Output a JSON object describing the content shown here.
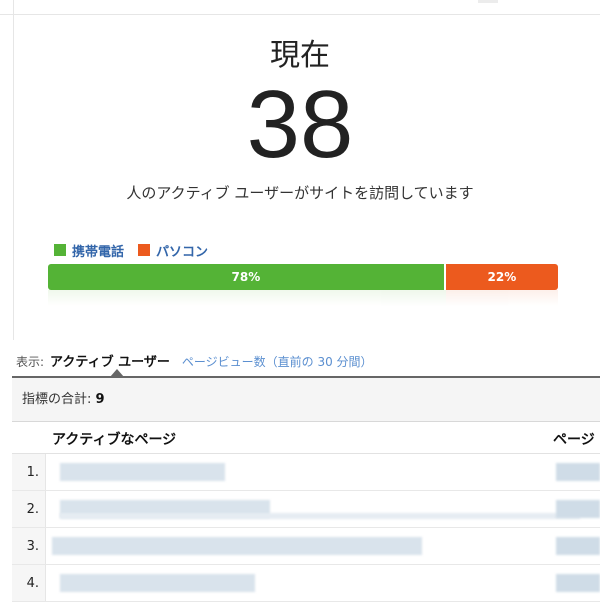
{
  "realtime": {
    "title": "現在",
    "active_count": "38",
    "subtitle": "人のアクティブ ユーザーがサイトを訪問しています"
  },
  "device_legend": [
    {
      "label": "携帯電話",
      "color": "#54b336"
    },
    {
      "label": "パソコン",
      "color": "#ec5a1e"
    }
  ],
  "device_split": [
    {
      "label": "78%",
      "value": 78,
      "color": "#54b336"
    },
    {
      "label": "22%",
      "value": 22,
      "color": "#ec5a1e"
    }
  ],
  "view_selector": {
    "prefix": "表示:",
    "active": "アクティブ ユーザー",
    "link": "ページビュー数（直前の 30 分間）"
  },
  "table": {
    "metric_total_label": "指標の合計:",
    "metric_total_value": "9",
    "columns": [
      "アクティブなページ",
      "ページ"
    ],
    "rows": [
      {
        "num": "1."
      },
      {
        "num": "2."
      },
      {
        "num": "3."
      },
      {
        "num": "4."
      }
    ]
  }
}
